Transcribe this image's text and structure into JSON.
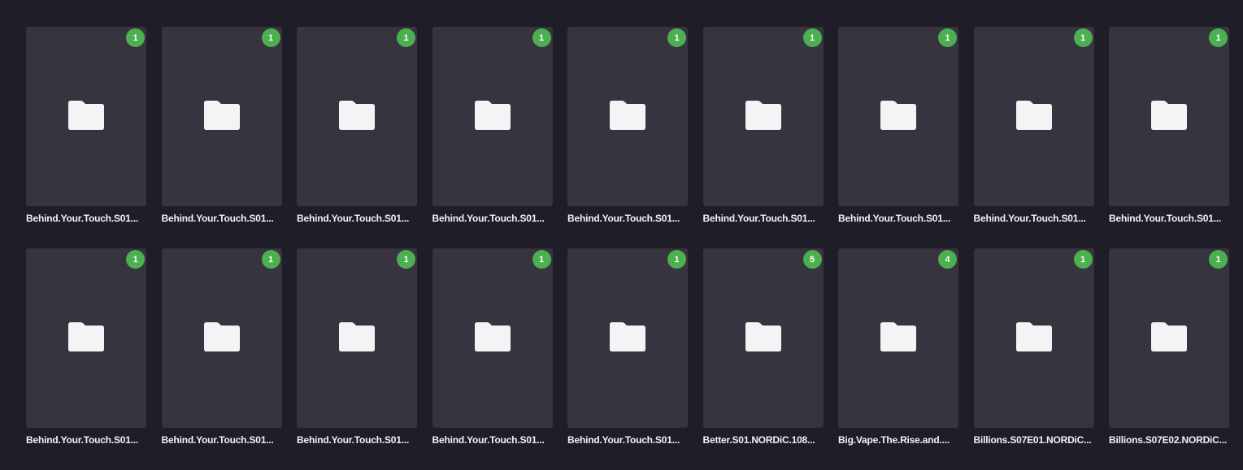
{
  "colors": {
    "background": "#1f1d27",
    "card": "#38343f",
    "badge": "#4caf50",
    "folder": "#f4f4f6"
  },
  "folders": [
    {
      "name": "Behind.Your.Touch.S01...",
      "count": "1"
    },
    {
      "name": "Behind.Your.Touch.S01...",
      "count": "1"
    },
    {
      "name": "Behind.Your.Touch.S01...",
      "count": "1"
    },
    {
      "name": "Behind.Your.Touch.S01...",
      "count": "1"
    },
    {
      "name": "Behind.Your.Touch.S01...",
      "count": "1"
    },
    {
      "name": "Behind.Your.Touch.S01...",
      "count": "1"
    },
    {
      "name": "Behind.Your.Touch.S01...",
      "count": "1"
    },
    {
      "name": "Behind.Your.Touch.S01...",
      "count": "1"
    },
    {
      "name": "Behind.Your.Touch.S01...",
      "count": "1"
    },
    {
      "name": "Behind.Your.Touch.S01...",
      "count": "1"
    },
    {
      "name": "Behind.Your.Touch.S01...",
      "count": "1"
    },
    {
      "name": "Behind.Your.Touch.S01...",
      "count": "1"
    },
    {
      "name": "Behind.Your.Touch.S01...",
      "count": "1"
    },
    {
      "name": "Behind.Your.Touch.S01...",
      "count": "1"
    },
    {
      "name": "Better.S01.NORDiC.108...",
      "count": "5"
    },
    {
      "name": "Big.Vape.The.Rise.and....",
      "count": "4"
    },
    {
      "name": "Billions.S07E01.NORDiC...",
      "count": "1"
    },
    {
      "name": "Billions.S07E02.NORDiC...",
      "count": "1"
    }
  ]
}
